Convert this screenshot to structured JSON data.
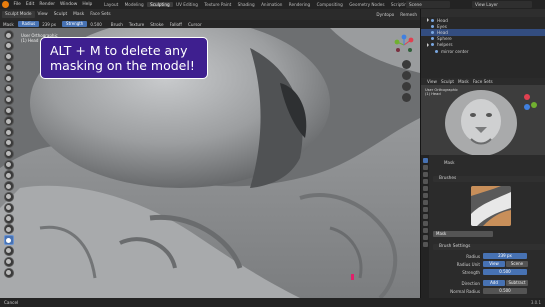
{
  "menubar": {
    "menus": [
      "File",
      "Edit",
      "Render",
      "Window",
      "Help"
    ],
    "workspaces": [
      "Layout",
      "Modeling",
      "Sculpting",
      "UV Editing",
      "Texture Paint",
      "Shading",
      "Animation",
      "Rendering",
      "Compositing",
      "Geometry Nodes",
      "Scripting"
    ],
    "active_workspace": "Sculpting",
    "scene": "Scene",
    "view_layer": "View Layer"
  },
  "header": {
    "mode": "Sculpt Mode",
    "menus": [
      "View",
      "Sculpt",
      "Mask",
      "Face Sets"
    ],
    "right_menus": [
      "Dyntopo",
      "Remesh"
    ]
  },
  "toolrow": {
    "tool": "Mask",
    "radius_label": "Radius",
    "radius_value": "239 px",
    "strength_label": "Strength",
    "strength_value": "0.500",
    "dropdowns": [
      "Brush",
      "Texture",
      "Stroke",
      "Falloff",
      "Cursor"
    ]
  },
  "viewport": {
    "info_line1": "User Orthographic",
    "info_line2": "(1) Head"
  },
  "tooltip": {
    "text": "ALT + M to delete any masking on the model!"
  },
  "outliner": {
    "items": [
      {
        "label": "Head",
        "selected": false
      },
      {
        "label": "Eyes",
        "selected": false
      },
      {
        "label": "Head",
        "selected": true
      },
      {
        "label": "Sphere",
        "selected": false
      },
      {
        "label": "helpers",
        "selected": false
      },
      {
        "label": "mirror center",
        "selected": false
      }
    ]
  },
  "preview_header": {
    "menus": [
      "View",
      "Sculpt",
      "Mask",
      "Face Sets"
    ]
  },
  "preview": {
    "info_line1": "User Orthographic",
    "info_line2": "(1) Head"
  },
  "properties": {
    "tool_label": "Mask",
    "brushes_panel": "Brushes",
    "brush_name": "Mask",
    "brush_settings_panel": "Brush Settings",
    "radius_label": "Radius",
    "radius_value": "239 px",
    "radius_unit_label": "Radius Unit",
    "radius_unit_view": "View",
    "radius_unit_scene": "Scene",
    "strength_label": "Strength",
    "strength_value": "0.500",
    "direction_label": "Direction",
    "direction_add": "Add",
    "direction_subtract": "Subtract",
    "normal_radius_label": "Normal Radius",
    "normal_radius_value": "0.500"
  },
  "statusbar": {
    "text": "Cancel",
    "version": "3.0.1"
  },
  "colors": {
    "accent": "#4772b3",
    "tooltip_bg": "#3e1f8f",
    "tooltip_border": "#ffffff"
  }
}
